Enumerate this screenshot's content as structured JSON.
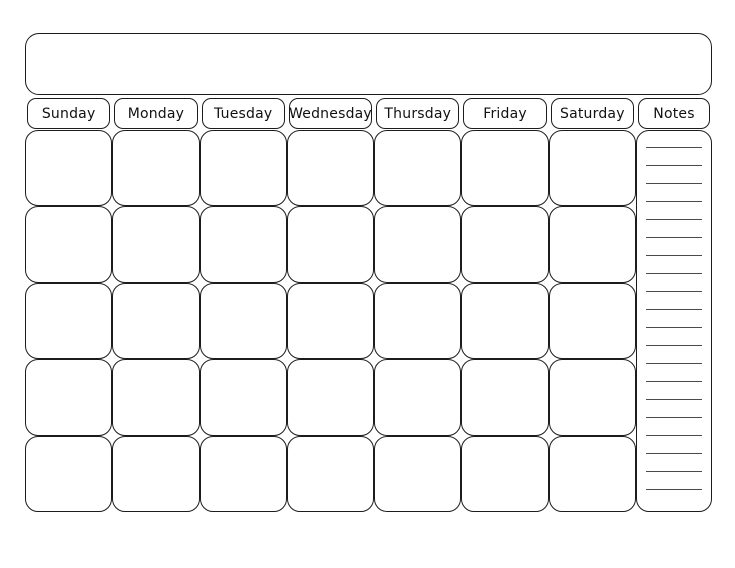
{
  "document": {
    "type": "blank-monthly-calendar-template",
    "title_bar_value": "",
    "title_bar_placeholder": ""
  },
  "header": {
    "day_columns": [
      {
        "label": "Sunday"
      },
      {
        "label": "Monday"
      },
      {
        "label": "Tuesday"
      },
      {
        "label": "Wednesday"
      },
      {
        "label": "Thursday"
      },
      {
        "label": "Friday"
      },
      {
        "label": "Saturday"
      }
    ],
    "notes_label": "Notes"
  },
  "grid": {
    "columns": 7,
    "rows": 5,
    "cells": [
      {
        "value": ""
      },
      {
        "value": ""
      },
      {
        "value": ""
      },
      {
        "value": ""
      },
      {
        "value": ""
      },
      {
        "value": ""
      },
      {
        "value": ""
      },
      {
        "value": ""
      },
      {
        "value": ""
      },
      {
        "value": ""
      },
      {
        "value": ""
      },
      {
        "value": ""
      },
      {
        "value": ""
      },
      {
        "value": ""
      },
      {
        "value": ""
      },
      {
        "value": ""
      },
      {
        "value": ""
      },
      {
        "value": ""
      },
      {
        "value": ""
      },
      {
        "value": ""
      },
      {
        "value": ""
      },
      {
        "value": ""
      },
      {
        "value": ""
      },
      {
        "value": ""
      },
      {
        "value": ""
      },
      {
        "value": ""
      },
      {
        "value": ""
      },
      {
        "value": ""
      },
      {
        "value": ""
      },
      {
        "value": ""
      },
      {
        "value": ""
      },
      {
        "value": ""
      },
      {
        "value": ""
      },
      {
        "value": ""
      },
      {
        "value": ""
      }
    ]
  },
  "notes": {
    "line_count": 20,
    "lines": [
      "",
      "",
      "",
      "",
      "",
      "",
      "",
      "",
      "",
      "",
      "",
      "",
      "",
      "",
      "",
      "",
      "",
      "",
      "",
      ""
    ]
  },
  "colors": {
    "page_background": "#ffffff",
    "stroke": "#1c1c1c",
    "text": "#111111",
    "rule_line": "#4a4a4a"
  }
}
